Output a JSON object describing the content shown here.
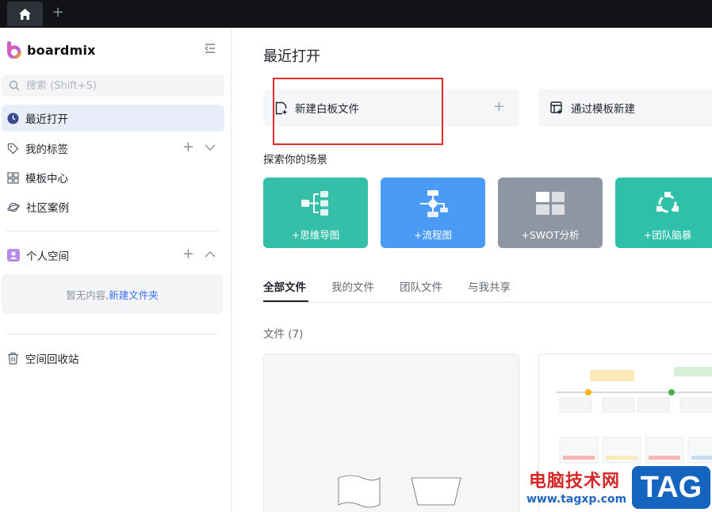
{
  "browser": {
    "home_icon": "home-icon",
    "new_tab_symbol": "+"
  },
  "sidebar": {
    "logo_text": "boardmix",
    "search_placeholder": "搜索 (Shift+S)",
    "items": [
      {
        "label": "最近打开",
        "icon": "clock-icon",
        "active": true
      },
      {
        "label": "我的标签",
        "icon": "tag-icon"
      },
      {
        "label": "模板中心",
        "icon": "grid-icon"
      },
      {
        "label": "社区案例",
        "icon": "planet-icon"
      }
    ],
    "personal_space": {
      "label": "个人空间",
      "icon": "person-icon"
    },
    "empty_text": "暂无内容,",
    "new_folder_link": "新建文件夹",
    "trash": {
      "label": "空间回收站",
      "icon": "trash-icon"
    }
  },
  "main": {
    "title": "最近打开",
    "actions": [
      {
        "label": "新建白板文件",
        "icon": "new-file-icon",
        "plus": "+"
      },
      {
        "label": "通过模板新建",
        "icon": "template-icon"
      }
    ],
    "scenes_title": "探索你的场景",
    "scenes": [
      {
        "label": "+思维导图",
        "color": "#35bfa9",
        "icon": "mindmap-icon"
      },
      {
        "label": "+流程图",
        "color": "#4a9bf5",
        "icon": "flowchart-icon"
      },
      {
        "label": "+SWOT分析",
        "color": "#8e95a3",
        "icon": "swot-icon"
      },
      {
        "label": "+团队脑暴",
        "color": "#2ec0a8",
        "icon": "brainstorm-icon"
      }
    ],
    "tabs": [
      "全部文件",
      "我的文件",
      "团队文件",
      "与我共享"
    ],
    "files_count": "文件 (7)"
  },
  "watermark": {
    "cn": "电脑技术网",
    "url": "www.tagxp.com",
    "tag": "TAG"
  },
  "colors": {
    "accent": "#3b6ef5",
    "highlight": "#e02b2b"
  }
}
